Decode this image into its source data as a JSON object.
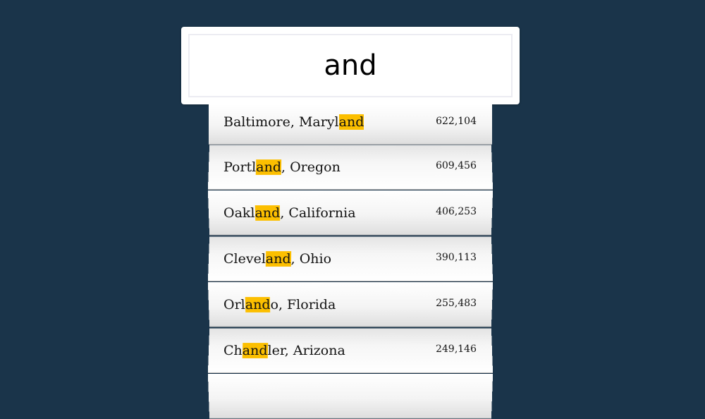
{
  "search": {
    "value": "and"
  },
  "results": [
    {
      "pre": "Baltimore, Maryl",
      "match": "and",
      "post": "",
      "population": "622,104"
    },
    {
      "pre": "Portl",
      "match": "and",
      "post": ", Oregon",
      "population": "609,456"
    },
    {
      "pre": "Oakl",
      "match": "and",
      "post": ", California",
      "population": "406,253"
    },
    {
      "pre": "Clevel",
      "match": "and",
      "post": ", Ohio",
      "population": "390,113"
    },
    {
      "pre": "Orl",
      "match": "and",
      "post": "o, Florida",
      "population": "255,483"
    },
    {
      "pre": "Ch",
      "match": "and",
      "post": "ler, Arizona",
      "population": "249,146"
    },
    {
      "pre": "",
      "match": "",
      "post": "",
      "population": ""
    }
  ],
  "colors": {
    "background": "#1a344a",
    "highlight": "#fcbf00"
  }
}
